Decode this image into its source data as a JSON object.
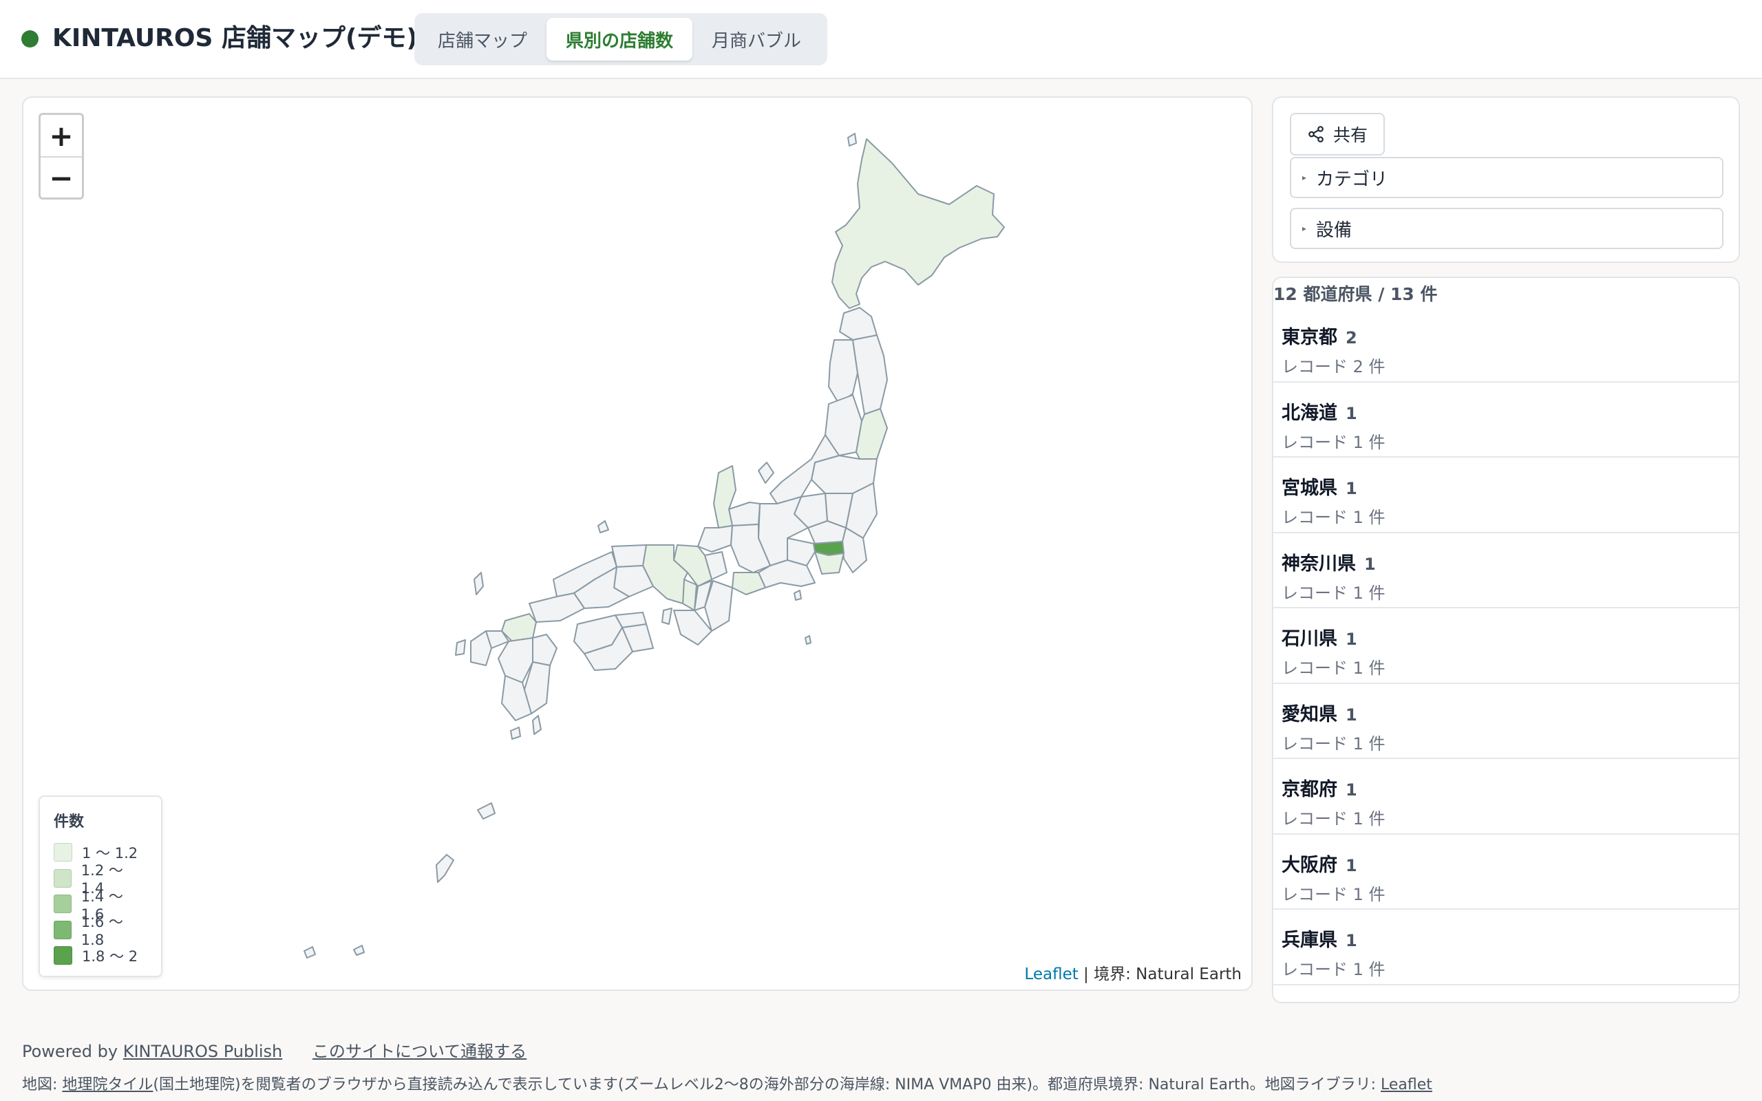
{
  "header": {
    "title": "KINTAUROS 店舗マップ(デモ)",
    "tabs": [
      {
        "label": "店舗マップ",
        "active": false
      },
      {
        "label": "県別の店舗数",
        "active": true
      },
      {
        "label": "月商バブル",
        "active": false
      }
    ]
  },
  "map": {
    "zoom_in": "+",
    "zoom_out": "−",
    "legend": {
      "title": "件数",
      "items": [
        {
          "label": "1 〜 1.2",
          "color": "#e8f2e4"
        },
        {
          "label": "1.2 〜 1.4",
          "color": "#cfe5c8"
        },
        {
          "label": "1.4 〜 1.6",
          "color": "#a7cf9c"
        },
        {
          "label": "1.6 〜 1.8",
          "color": "#7db973"
        },
        {
          "label": "1.8 〜 2",
          "color": "#5aa24e"
        }
      ]
    },
    "attribution_link": "Leaflet",
    "attribution_text": " | 境界: Natural Earth"
  },
  "filters": {
    "share_label": "共有",
    "accordions": [
      {
        "label": "カテゴリ"
      },
      {
        "label": "設備"
      }
    ]
  },
  "list": {
    "summary": "12 都道府県 / 13 件",
    "items": [
      {
        "name": "東京都",
        "count": "2",
        "sub": "レコード 2 件"
      },
      {
        "name": "北海道",
        "count": "1",
        "sub": "レコード 1 件"
      },
      {
        "name": "宮城県",
        "count": "1",
        "sub": "レコード 1 件"
      },
      {
        "name": "神奈川県",
        "count": "1",
        "sub": "レコード 1 件"
      },
      {
        "name": "石川県",
        "count": "1",
        "sub": "レコード 1 件"
      },
      {
        "name": "愛知県",
        "count": "1",
        "sub": "レコード 1 件"
      },
      {
        "name": "京都府",
        "count": "1",
        "sub": "レコード 1 件"
      },
      {
        "name": "大阪府",
        "count": "1",
        "sub": "レコード 1 件"
      },
      {
        "name": "兵庫県",
        "count": "1",
        "sub": "レコード 1 件"
      }
    ]
  },
  "footer": {
    "powered_prefix": "Powered by ",
    "powered_link": "KINTAUROS Publish",
    "report_link": "このサイトについて通報する",
    "notice_prefix": "地図: ",
    "notice_link1": "地理院タイル",
    "notice_mid": "(国土地理院)を閲覧者のブラウザから直接読み込んで表示しています(ズームレベル2〜8の海外部分の海岸線: NIMA VMAP0 由来)。都道府県境界: Natural Earth。地図ライブラリ: ",
    "notice_link2": "Leaflet"
  },
  "colors": {
    "accent": "#2e7d32",
    "default_pref": "#f1f3f5",
    "pref_stroke": "#8a9aa5"
  }
}
